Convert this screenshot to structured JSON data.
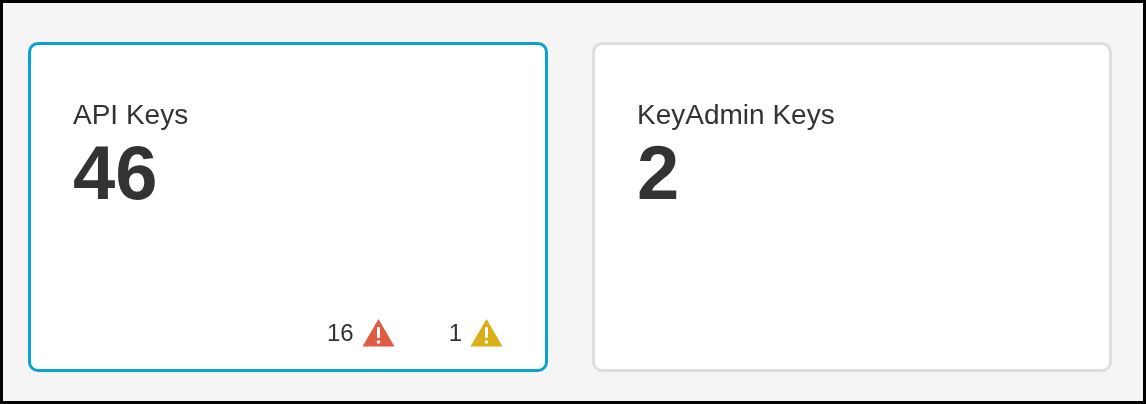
{
  "cards": [
    {
      "title": "API Keys",
      "count": "46",
      "selected": true,
      "alerts": [
        {
          "count": "16",
          "color": "#e05a44"
        },
        {
          "count": "1",
          "color": "#d9ae17"
        }
      ]
    },
    {
      "title": "KeyAdmin Keys",
      "count": "2",
      "selected": false
    }
  ]
}
